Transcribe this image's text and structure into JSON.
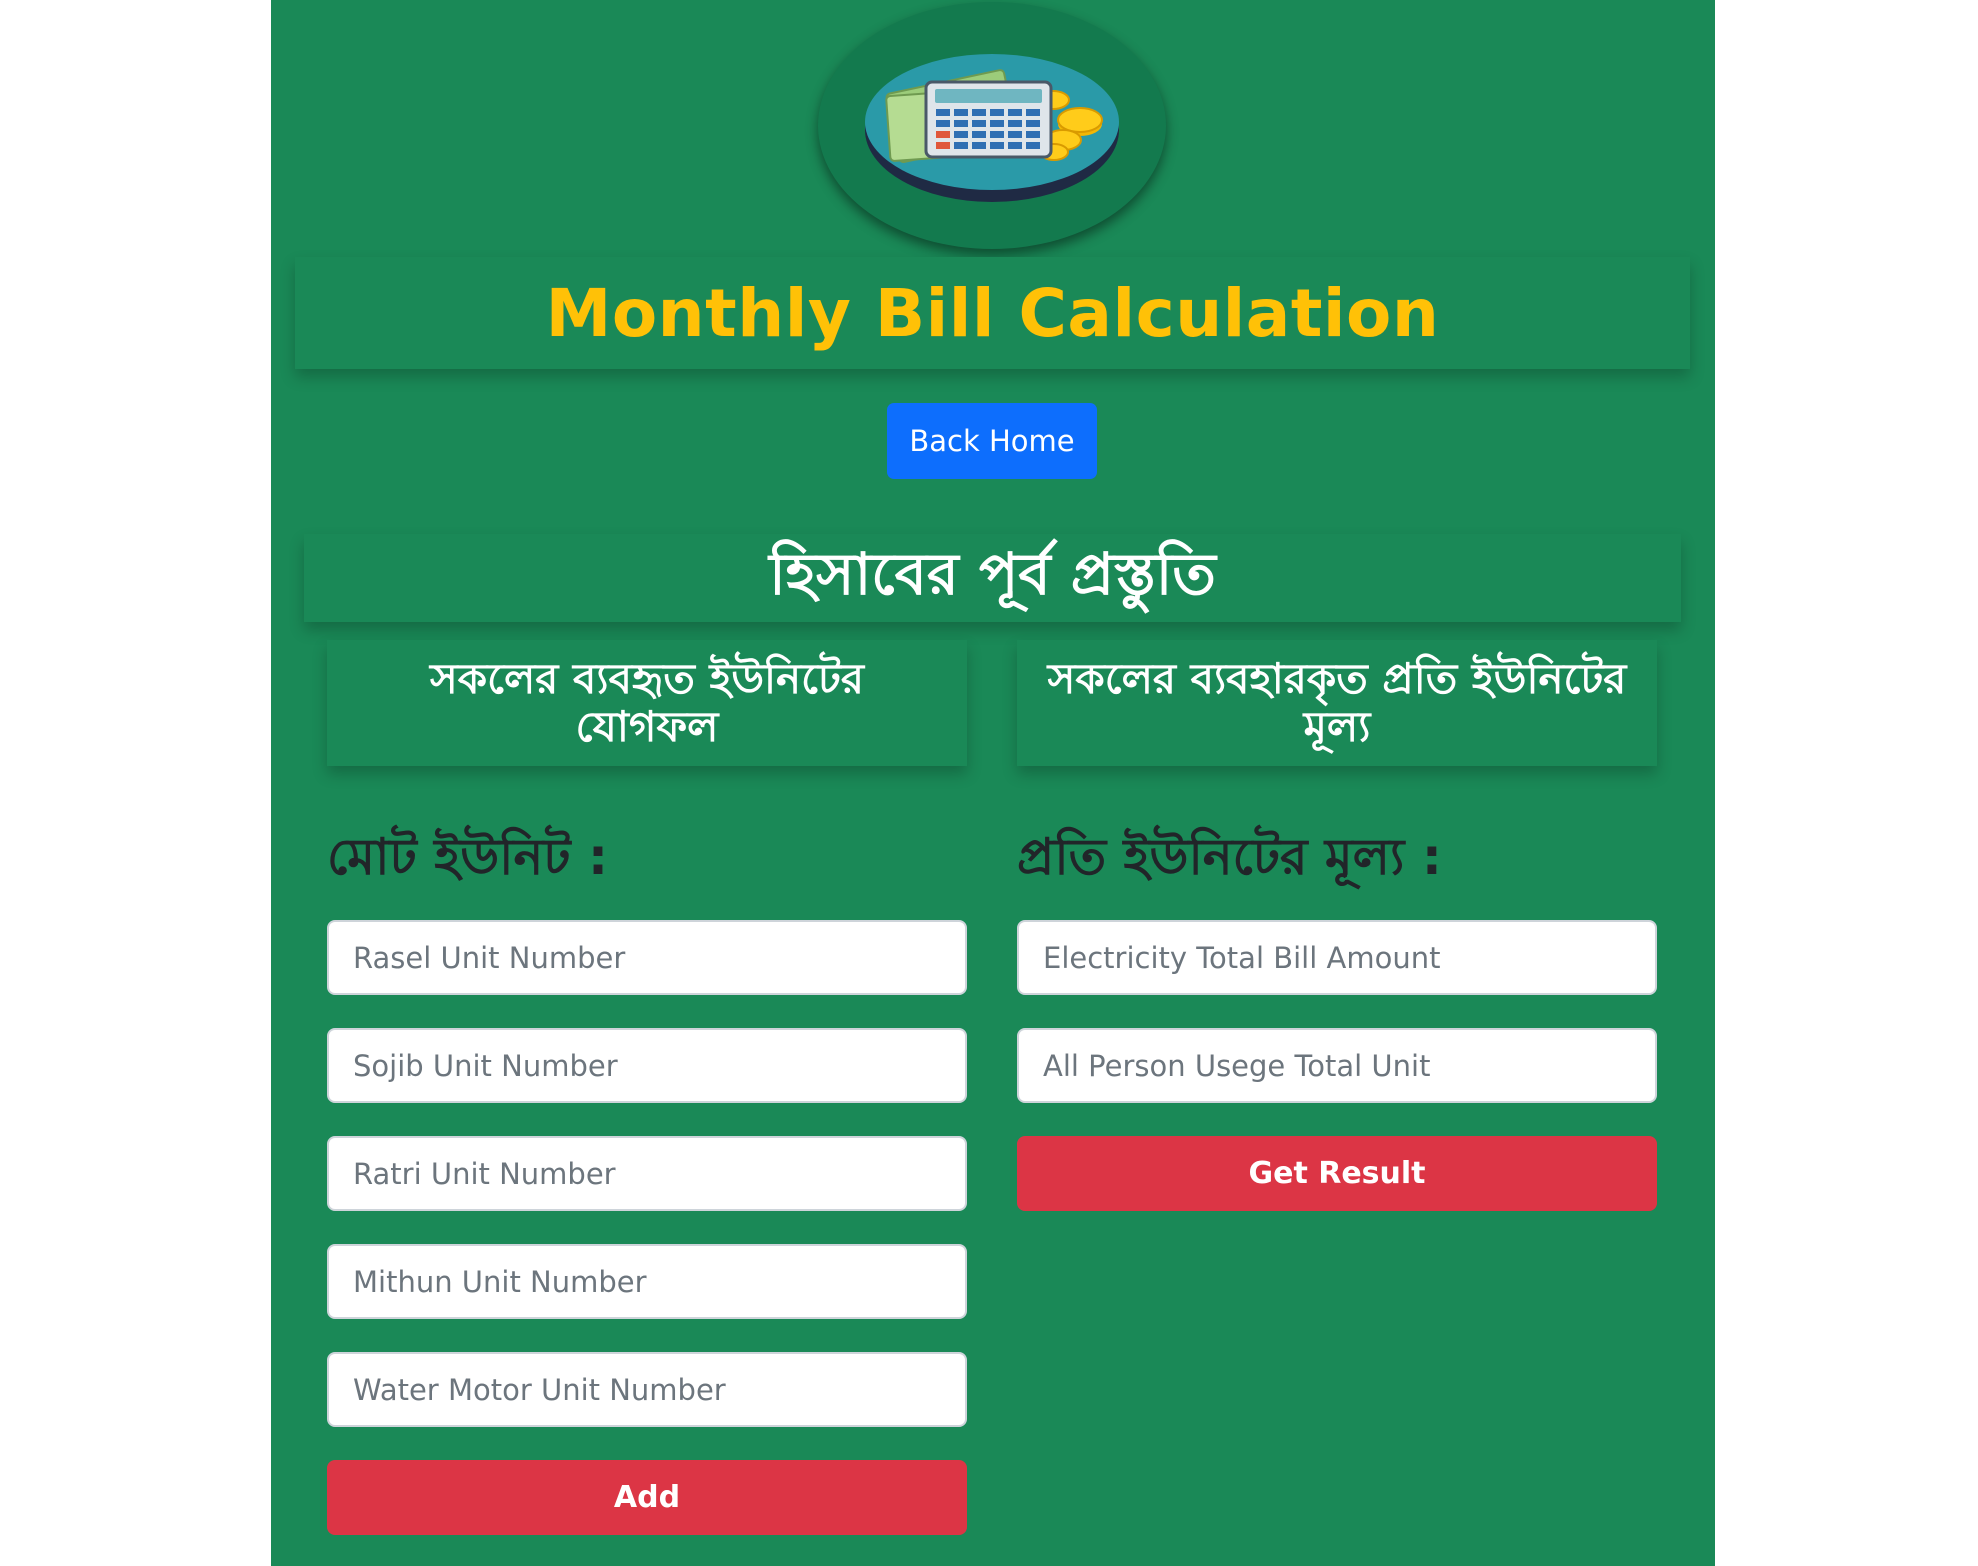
{
  "header": {
    "logo": "calculator-money-logo",
    "title": "Monthly Bill Calculation"
  },
  "nav": {
    "back_label": "Back Home"
  },
  "section": {
    "title": "হিসাবের পূর্ব প্রস্তুতি"
  },
  "left_column": {
    "card_title": "সকলের ব্যবহৃত ইউনিটের যোগফল",
    "label": "মোট ইউনিট :",
    "inputs": [
      {
        "placeholder": "Rasel Unit Number",
        "value": ""
      },
      {
        "placeholder": "Sojib Unit Number",
        "value": ""
      },
      {
        "placeholder": "Ratri Unit Number",
        "value": ""
      },
      {
        "placeholder": "Mithun Unit Number",
        "value": ""
      },
      {
        "placeholder": "Water Motor Unit Number",
        "value": ""
      }
    ],
    "button_label": "Add"
  },
  "right_column": {
    "card_title": "সকলের ব্যবহারকৃত প্রতি ইউনিটের মূল্য",
    "label": "প্রতি ইউনিটের মূল্য :",
    "inputs": [
      {
        "placeholder": "Electricity Total Bill Amount",
        "value": ""
      },
      {
        "placeholder": "All Person Usege Total Unit",
        "value": ""
      }
    ],
    "button_label": "Get Result"
  },
  "colors": {
    "page_background": "#1a8957",
    "title_color": "#ffc107",
    "primary_button": "#0d6efd",
    "danger_button": "#dc3545"
  }
}
